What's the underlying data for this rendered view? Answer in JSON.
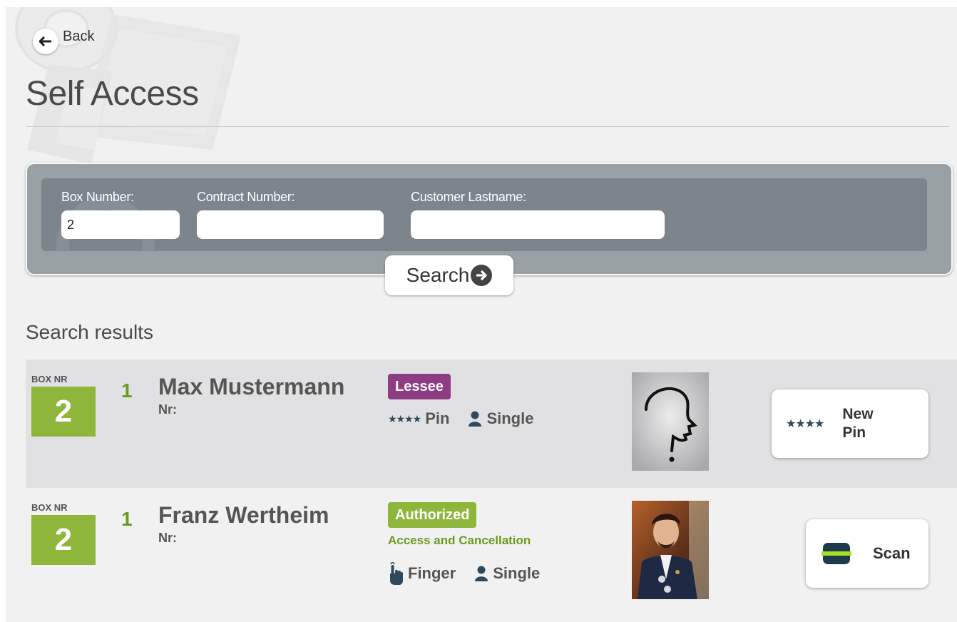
{
  "back": {
    "label": "Back",
    "icon": "arrow-left-icon"
  },
  "page": {
    "title": "Self Access"
  },
  "search": {
    "fields": [
      {
        "label": "Box Number:",
        "value": "2"
      },
      {
        "label": "Contract Number:",
        "value": ""
      },
      {
        "label": "Customer Lastname:",
        "value": ""
      }
    ],
    "button_label": "Search"
  },
  "results": {
    "title": "Search results",
    "rows": [
      {
        "box_label": "BOX NR",
        "box_number": "2",
        "seq": "1",
        "name": "Max Mustermann",
        "nr_label": "Nr:",
        "role": "Lessee",
        "role_color": "#8e3d82",
        "role_desc": "",
        "credential": "Pin",
        "credential_icon": "pin-stars-icon",
        "mode": "Single",
        "mode_icon": "person-icon",
        "photo": "unknown-person-question-mark",
        "action": {
          "stars": "★★★★",
          "label_line1": "New",
          "label_line2": "Pin"
        }
      },
      {
        "box_label": "BOX NR",
        "box_number": "2",
        "seq": "1",
        "name": "Franz Wertheim",
        "nr_label": "Nr:",
        "role": "Authorized",
        "role_color": "#8db63a",
        "role_desc": "Access and Cancellation",
        "credential": "Finger",
        "credential_icon": "finger-icon",
        "mode": "Single",
        "mode_icon": "person-icon",
        "photo": "portrait-painting",
        "action": {
          "label": "Scan",
          "icon": "fingerprint-scanner-icon"
        }
      }
    ]
  },
  "colors": {
    "accent_green": "#8db63a",
    "lessee_purple": "#8e3d82",
    "search_panel": "#7b858b"
  }
}
